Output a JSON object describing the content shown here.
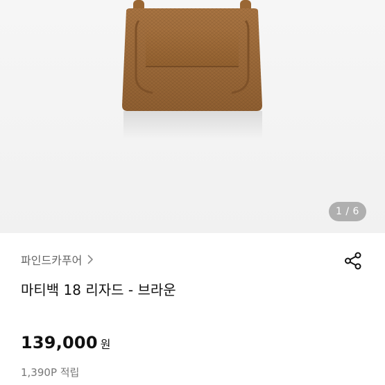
{
  "gallery": {
    "current": 1,
    "total": 6,
    "indicator_text": "1 / 6",
    "image_name": "bag-image",
    "bag_color": "#9b6a3a"
  },
  "product": {
    "brand": "파인드카푸어",
    "name": "마티백 18 리자드 - 브라운",
    "price": "139,000",
    "currency": "원",
    "points": "1,390P 적립"
  },
  "icons": {
    "brand_chevron": "chevron-right-icon",
    "share": "share-icon"
  }
}
